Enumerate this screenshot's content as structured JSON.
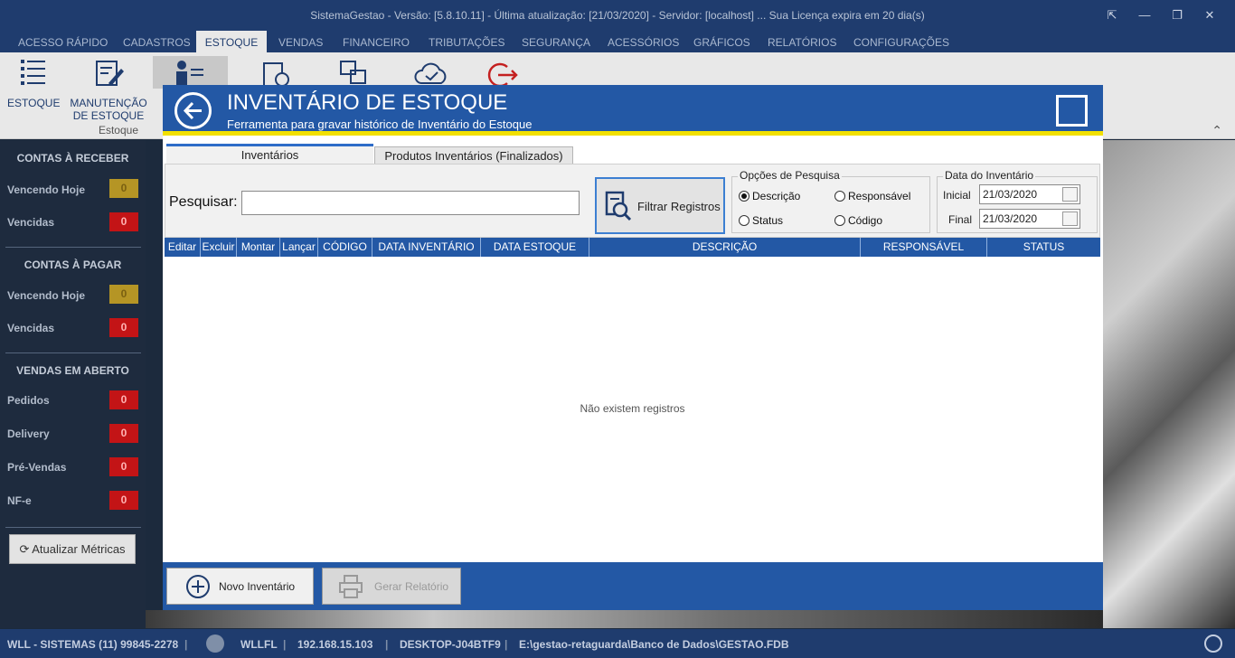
{
  "window": {
    "title": "SistemaGestao - Versão: [5.8.10.11] - Última atualização: [21/03/2020] - Servidor: [localhost] ... Sua Licença expira em 20 dia(s)",
    "buttons": [
      "⇱",
      "—",
      "❐",
      "✕"
    ]
  },
  "menu": {
    "tabs": [
      "ACESSO RÁPIDO",
      "CADASTROS",
      "ESTOQUE",
      "VENDAS",
      "FINANCEIRO",
      "TRIBUTAÇÕES",
      "SEGURANÇA",
      "ACESSÓRIOS",
      "GRÁFICOS",
      "RELATÓRIOS",
      "CONFIGURAÇÕES"
    ],
    "active": "ESTOQUE"
  },
  "ribbon": {
    "estoque_label": "ESTOQUE",
    "manutencao_label_1": "MANUTENÇÃO",
    "manutencao_label_2": "DE ESTOQUE",
    "group_label": "Estoque"
  },
  "sidebar": {
    "receber_title": "CONTAS À RECEBER",
    "pagar_title": "CONTAS À PAGAR",
    "vendas_title": "VENDAS EM ABERTO",
    "vencendo_hoje": "Vencendo Hoje",
    "vencidas": "Vencidas",
    "pedidos": "Pedidos",
    "delivery": "Delivery",
    "pre_vendas": "Pré-Vendas",
    "nfe": "NF-e",
    "zero": "0",
    "refresh_button": "Atualizar Métricas"
  },
  "statusbar": {
    "company": "WLL - SISTEMAS (11) 99845-2278",
    "user": "WLLFL",
    "ip": "192.168.15.103",
    "host": "DESKTOP-J04BTF9",
    "db_path": "E:\\gestao-retaguarda\\Banco de Dados\\GESTAO.FDB"
  },
  "dialog": {
    "title": "INVENTÁRIO DE ESTOQUE",
    "subtitle": "Ferramenta para gravar histórico de Inventário do Estoque",
    "tabs": [
      "Inventários",
      "Produtos Inventários (Finalizados)"
    ],
    "search_label": "Pesquisar:",
    "search_value": "",
    "filter_button": "Filtrar Registros",
    "options_title": "Opções de Pesquisa",
    "options": [
      "Descrição",
      "Responsável",
      "Status",
      "Código"
    ],
    "selected_option": "Descrição",
    "date_title": "Data do Inventário",
    "date_initial_label": "Inicial",
    "date_final_label": "Final",
    "date_initial": "21/03/2020",
    "date_final": "21/03/2020",
    "columns": [
      "Editar",
      "Excluir",
      "Montar",
      "Lançar",
      "CÓDIGO",
      "DATA INVENTÁRIO",
      "DATA ESTOQUE",
      "DESCRIÇÃO",
      "RESPONSÁVEL",
      "STATUS"
    ],
    "empty_message": "Não existem registros",
    "new_button": "Novo Inventário",
    "report_button": "Gerar Relatório"
  },
  "colors": {
    "accent": "#2358a5",
    "titlebar": "#1f3c6e",
    "header_stripe": "#f2e000",
    "badge_red": "#c31416",
    "badge_yellow": "#b59525"
  }
}
